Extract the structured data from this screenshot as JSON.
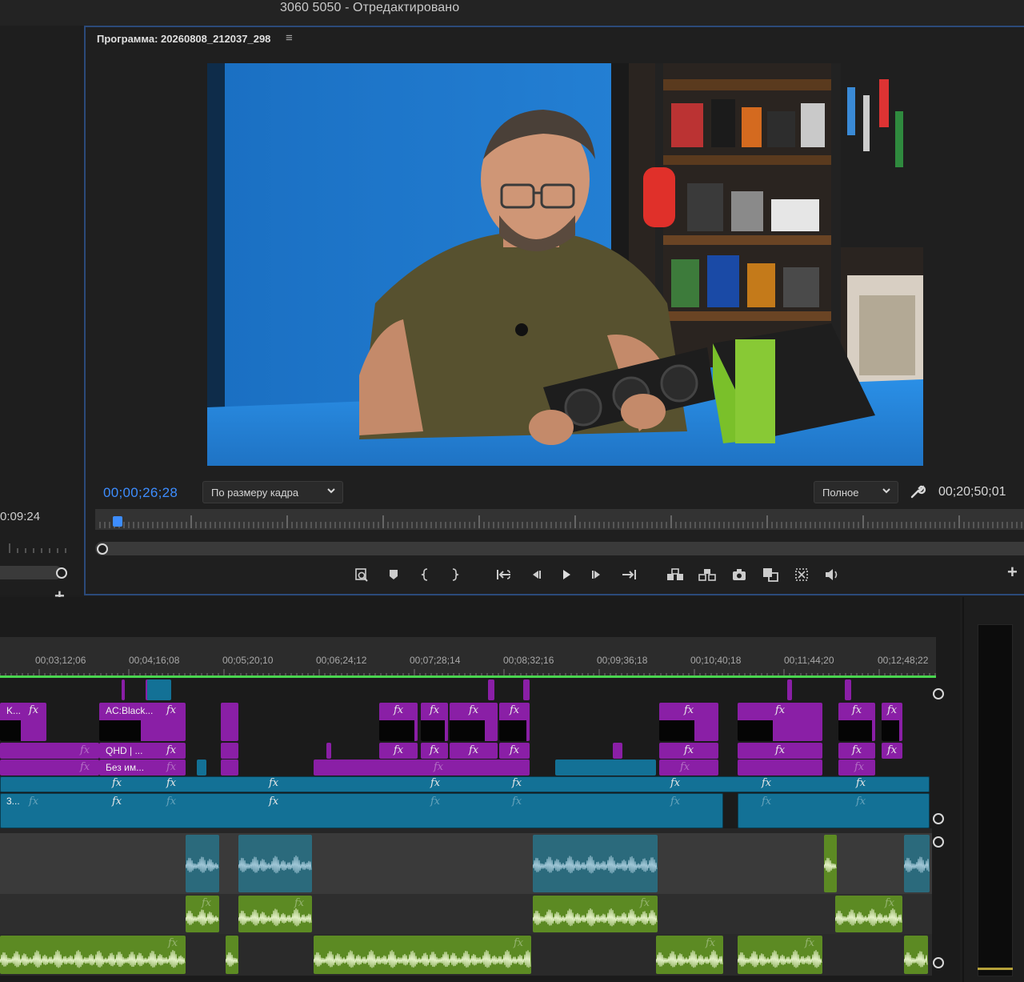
{
  "app": {
    "title": "3060 5050 - Отредактировано"
  },
  "source_monitor": {
    "timecode": "0:09:24"
  },
  "program_monitor": {
    "tab_label": "Программа: 20260808_212037_298",
    "current_timecode": "00;00;26;28",
    "zoom_dropdown": "По размеру кадра",
    "quality_dropdown": "Полное",
    "duration": "00;20;50;01"
  },
  "transport": [
    {
      "name": "add-marker-icon"
    },
    {
      "name": "marker-icon"
    },
    {
      "name": "mark-in-icon"
    },
    {
      "name": "mark-out-icon"
    },
    {
      "name": "go-to-in-icon"
    },
    {
      "name": "step-back-icon"
    },
    {
      "name": "play-icon"
    },
    {
      "name": "step-forward-icon"
    },
    {
      "name": "go-to-out-icon"
    },
    {
      "name": "lift-icon"
    },
    {
      "name": "extract-icon"
    },
    {
      "name": "export-frame-icon"
    },
    {
      "name": "comparison-view-icon"
    },
    {
      "name": "proxy-toggle-icon"
    },
    {
      "name": "volume-icon"
    }
  ],
  "timeline": {
    "timecodes": [
      "00;03;12;06",
      "00;04;16;08",
      "00;05;20;10",
      "00;06;24;12",
      "00;07;28;14",
      "00;08;32;16",
      "00;09;36;18",
      "00;10;40;18",
      "00;11;44;20",
      "00;12;48;22"
    ],
    "clip_labels": {
      "v5_first": "K...",
      "acblack": "AC:Black...",
      "qhd": "QHD | ...",
      "bez_imeni": "Без им...",
      "v1_first": "3..."
    },
    "fx_label": "fx"
  },
  "colors": {
    "accent_blue": "#3d8dff",
    "panel_border": "#2b4a7a",
    "clip_purple": "#8a1fa6",
    "clip_teal": "#137196",
    "audio_green": "#5c8a23",
    "audio_teal": "#2b6a7c",
    "playhead_green": "#49d64f"
  }
}
